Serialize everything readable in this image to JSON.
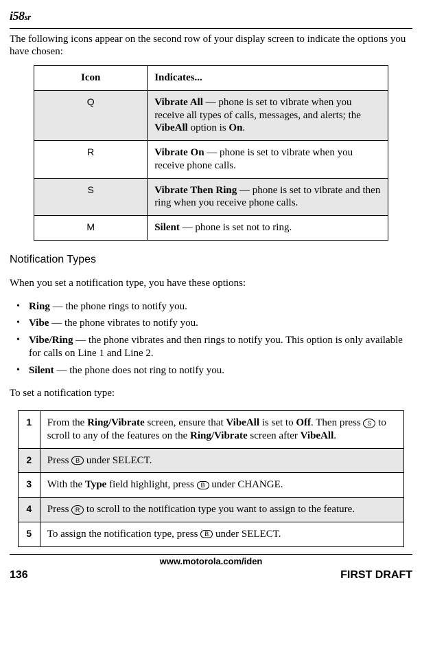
{
  "logo": {
    "main": "i58",
    "suffix": "sr"
  },
  "intro": "The following icons appear on the second row of your display screen to indicate the options you have chosen:",
  "iconTable": {
    "header": {
      "col1": "Icon",
      "col2": "Indicates..."
    },
    "rows": [
      {
        "iconName": "vibrate-all-icon",
        "iconGlyph": "Q",
        "boldLead": "Vibrate All",
        "rest": " — phone is set to vibrate when you receive all types of calls, messages, and alerts; the ",
        "bold2": "VibeAll",
        "rest2": " option is ",
        "bold3": "On",
        "rest3": "."
      },
      {
        "iconName": "vibrate-on-icon",
        "iconGlyph": "R",
        "boldLead": "Vibrate On",
        "rest": " — phone is set to vibrate when you receive phone calls.",
        "bold2": "",
        "rest2": "",
        "bold3": "",
        "rest3": ""
      },
      {
        "iconName": "vibrate-then-ring-icon",
        "iconGlyph": "S",
        "boldLead": "Vibrate Then Ring",
        "rest": " — phone is set to vibrate and then ring when you receive phone calls.",
        "bold2": "",
        "rest2": "",
        "bold3": "",
        "rest3": ""
      },
      {
        "iconName": "silent-icon",
        "iconGlyph": "M",
        "boldLead": "Silent",
        "rest": " — phone is set not to ring.",
        "bold2": "",
        "rest2": "",
        "bold3": "",
        "rest3": ""
      }
    ]
  },
  "section2": {
    "heading": "Notification Types",
    "lead": "When you set a notification type, you have these options:",
    "options": [
      {
        "bold": "Ring",
        "rest": " — the phone rings to notify you."
      },
      {
        "bold": "Vibe",
        "rest": " — the phone vibrates to notify you."
      },
      {
        "bold": "Vibe/Ring",
        "rest": " — the phone vibrates and then rings to notify you. This option is only available for calls on Line 1 and Line 2."
      },
      {
        "bold": "Silent",
        "rest": " — the phone does not ring to notify you."
      }
    ],
    "lead2": "To set a notification type:"
  },
  "steps": [
    {
      "num": "1",
      "pre": "From the ",
      "b1": "Ring/Vibrate",
      "mid1": " screen, ensure that ",
      "b2": "VibeAll",
      "mid2": " is set to ",
      "b3": "Off",
      "mid3": ". Then press ",
      "glyphName": "nav-key-icon",
      "glyph": "S",
      "glyphRound": true,
      "mid4": " to scroll to any of the features on the ",
      "b4": "Ring/Vibrate",
      "mid5": " screen after ",
      "b5": "VibeAll",
      "tail": "."
    },
    {
      "num": "2",
      "pre": "Press ",
      "b1": "",
      "mid1": "",
      "b2": "",
      "mid2": "",
      "b3": "",
      "mid3": "",
      "glyphName": "softkey-icon",
      "glyph": "B",
      "glyphRound": false,
      "mid4": " under SELECT.",
      "b4": "",
      "mid5": "",
      "b5": "",
      "tail": ""
    },
    {
      "num": "3",
      "pre": "With the ",
      "b1": "Type",
      "mid1": " field highlight, press ",
      "b2": "",
      "mid2": "",
      "b3": "",
      "mid3": "",
      "glyphName": "softkey-icon",
      "glyph": "B",
      "glyphRound": false,
      "mid4": " under CHANGE.",
      "b4": "",
      "mid5": "",
      "b5": "",
      "tail": ""
    },
    {
      "num": "4",
      "pre": "Press ",
      "b1": "",
      "mid1": "",
      "b2": "",
      "mid2": "",
      "b3": "",
      "mid3": "",
      "glyphName": "nav-key-icon",
      "glyph": "R",
      "glyphRound": true,
      "mid4": " to scroll to the notification type you want to assign to the feature.",
      "b4": "",
      "mid5": "",
      "b5": "",
      "tail": ""
    },
    {
      "num": "5",
      "pre": "To assign the notification type, press ",
      "b1": "",
      "mid1": "",
      "b2": "",
      "mid2": "",
      "b3": "",
      "mid3": "",
      "glyphName": "softkey-icon",
      "glyph": "B",
      "glyphRound": false,
      "mid4": " under SELECT.",
      "b4": "",
      "mid5": "",
      "b5": "",
      "tail": ""
    }
  ],
  "footer": {
    "url": "www.motorola.com/iden",
    "pageNum": "136",
    "draft": "FIRST DRAFT"
  }
}
